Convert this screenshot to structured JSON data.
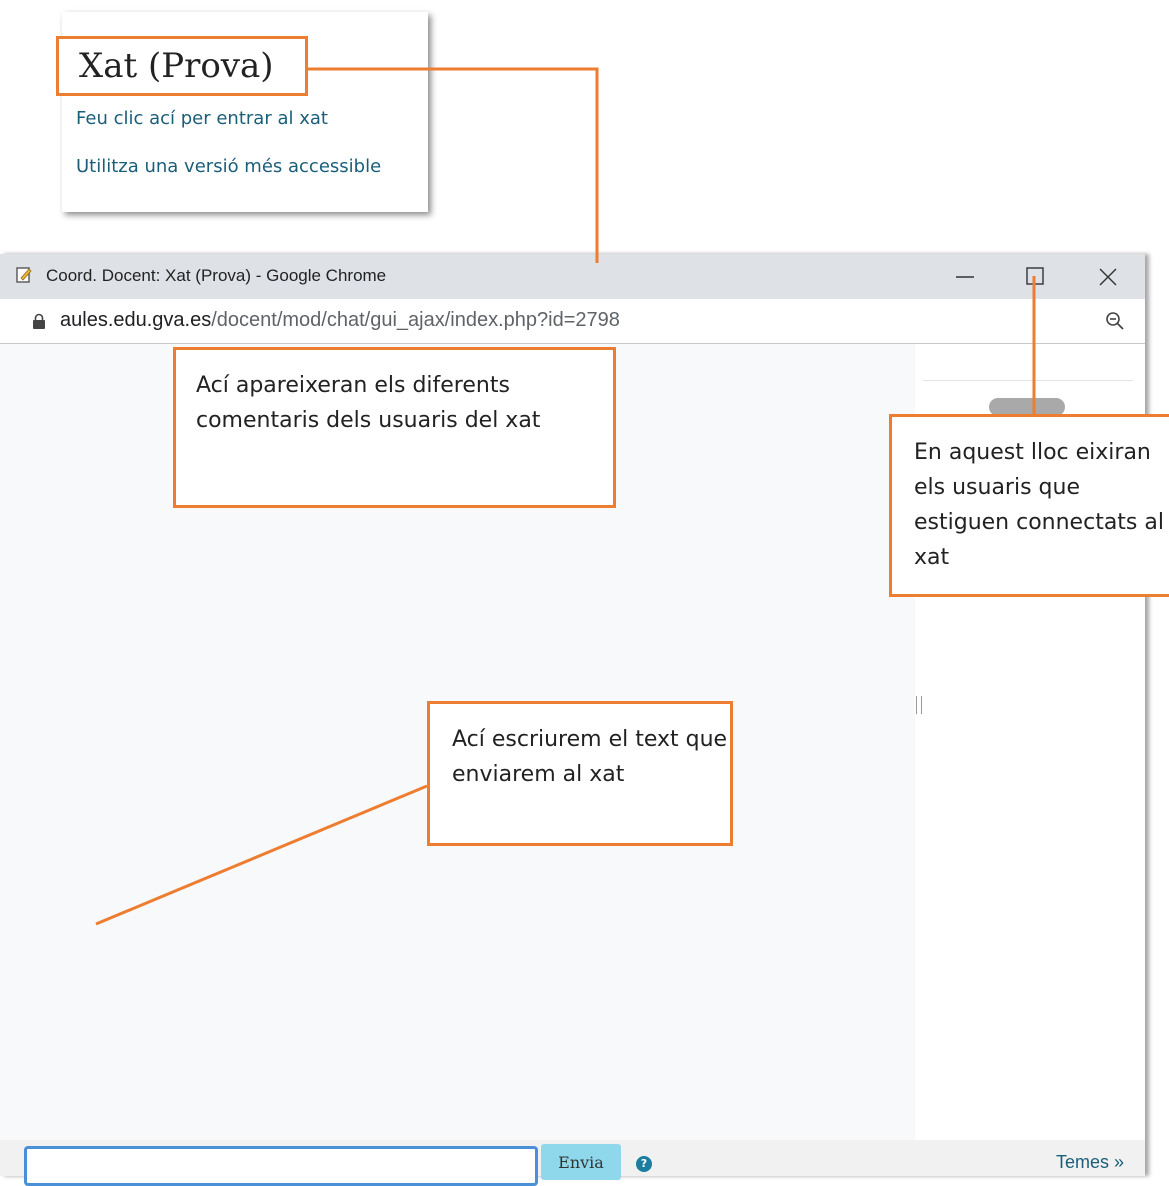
{
  "card": {
    "title": "Xat (Prova)",
    "links": [
      "Feu clic ací per entrar al xat",
      "Utilitza una versió més accessible"
    ]
  },
  "window": {
    "title": "Coord. Docent: Xat (Prova) - Google Chrome",
    "url_host": "aules.edu.gva.es",
    "url_path": "/docent/mod/chat/gui_ajax/index.php?id=2798",
    "icons": [
      "page-icon",
      "minimize-icon",
      "maximize-icon",
      "close-icon",
      "lock-icon",
      "zoom-out-icon"
    ]
  },
  "chat": {
    "input_value": "",
    "send_label": "Envia",
    "help_icon": "question-icon",
    "themes_label": "Temes »"
  },
  "annotations": {
    "messages": "Ací apareixeran els diferents comentaris dels usuaris del xat",
    "users": "En aquest lloc eixiran els usuaris que estiguen connectats al xat",
    "input": "Ací escriurem el text que enviarem al xat"
  },
  "colors": {
    "annotation": "#ed7d31",
    "link": "#1a5e7a",
    "send_button": "#8fd8ec",
    "input_border": "#4a90d9"
  }
}
